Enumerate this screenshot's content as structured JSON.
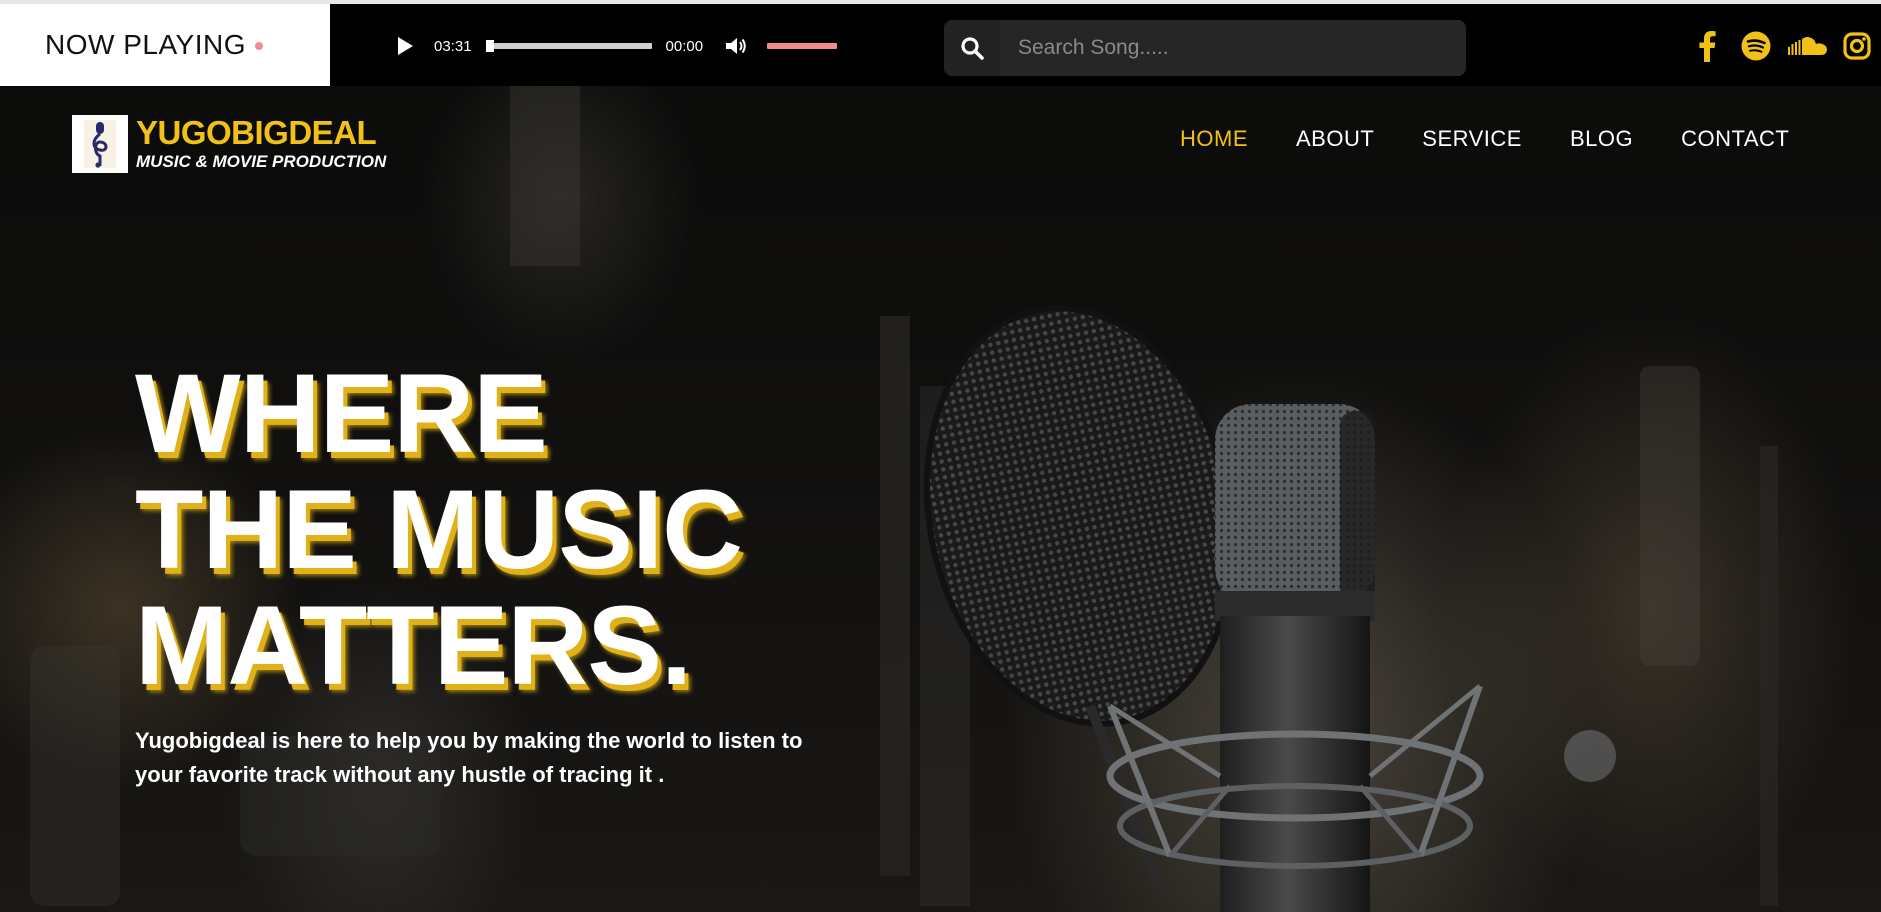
{
  "now_playing": {
    "label": "NOW PLAYING"
  },
  "player": {
    "current_time": "03:31",
    "duration": "00:00",
    "progress_fraction": 0.0,
    "volume_fraction": 1.0
  },
  "search": {
    "placeholder": "Search Song....."
  },
  "socials": [
    "facebook-icon",
    "spotify-icon",
    "soundcloud-icon",
    "instagram-icon"
  ],
  "brand": {
    "name": "YUGOBIGDEAL",
    "subtitle": "MUSIC & MOVIE PRODUCTION"
  },
  "nav": {
    "items": [
      {
        "label": "HOME",
        "active": true
      },
      {
        "label": "ABOUT",
        "active": false
      },
      {
        "label": "SERVICE",
        "active": false
      },
      {
        "label": "BLOG",
        "active": false
      },
      {
        "label": "CONTACT",
        "active": false
      }
    ]
  },
  "hero": {
    "headline_lines": [
      "WHERE",
      "THE MUSIC",
      "MATTERS."
    ],
    "tagline_lines": [
      "Yugobigdeal is here to help you by making the world to listen to",
      "your favorite track without any hustle of tracing it ."
    ]
  },
  "colors": {
    "accent": "#f2c118",
    "volume": "#f08c8c",
    "topbar": "#000000"
  }
}
